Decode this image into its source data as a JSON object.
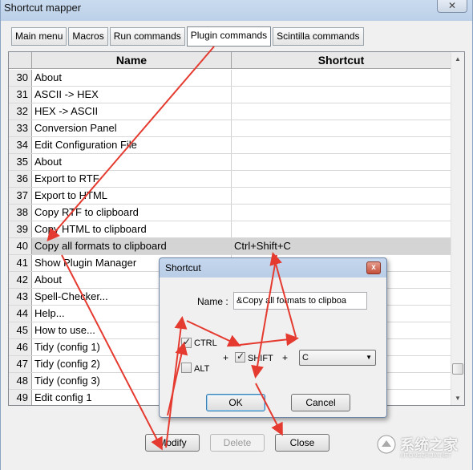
{
  "window": {
    "title": "Shortcut mapper",
    "close_glyph": "✕"
  },
  "tabs": [
    {
      "label": "Main menu",
      "active": false
    },
    {
      "label": "Macros",
      "active": false
    },
    {
      "label": "Run commands",
      "active": false
    },
    {
      "label": "Plugin commands",
      "active": true
    },
    {
      "label": "Scintilla commands",
      "active": false
    }
  ],
  "grid": {
    "headers": {
      "name": "Name",
      "shortcut": "Shortcut"
    },
    "rows": [
      {
        "num": "30",
        "name": "About",
        "shortcut": ""
      },
      {
        "num": "31",
        "name": "ASCII -> HEX",
        "shortcut": ""
      },
      {
        "num": "32",
        "name": "HEX -> ASCII",
        "shortcut": ""
      },
      {
        "num": "33",
        "name": "Conversion Panel",
        "shortcut": ""
      },
      {
        "num": "34",
        "name": "Edit Configuration File",
        "shortcut": ""
      },
      {
        "num": "35",
        "name": "About",
        "shortcut": ""
      },
      {
        "num": "36",
        "name": "Export to RTF",
        "shortcut": ""
      },
      {
        "num": "37",
        "name": "Export to HTML",
        "shortcut": ""
      },
      {
        "num": "38",
        "name": "Copy RTF to clipboard",
        "shortcut": ""
      },
      {
        "num": "39",
        "name": "Copy HTML to clipboard",
        "shortcut": ""
      },
      {
        "num": "40",
        "name": "Copy all formats to clipboard",
        "shortcut": "Ctrl+Shift+C",
        "selected": true
      },
      {
        "num": "41",
        "name": "Show Plugin Manager",
        "shortcut": ""
      },
      {
        "num": "42",
        "name": "About",
        "shortcut": ""
      },
      {
        "num": "43",
        "name": "Spell-Checker...",
        "shortcut": ""
      },
      {
        "num": "44",
        "name": "Help...",
        "shortcut": ""
      },
      {
        "num": "45",
        "name": "How to use...",
        "shortcut": ""
      },
      {
        "num": "46",
        "name": "Tidy (config 1)",
        "shortcut": ""
      },
      {
        "num": "47",
        "name": "Tidy (config 2)",
        "shortcut": ""
      },
      {
        "num": "48",
        "name": "Tidy (config 3)",
        "shortcut": ""
      },
      {
        "num": "49",
        "name": "Edit config 1",
        "shortcut": ""
      }
    ]
  },
  "buttons": {
    "modify": "Modify",
    "delete": "Delete",
    "close": "Close"
  },
  "dialog": {
    "title": "Shortcut",
    "close_glyph": "x",
    "name_label": "Name :",
    "name_value": "&Copy all formats to clipboa",
    "ctrl_label": "CTRL",
    "ctrl_checked": true,
    "alt_label": "ALT",
    "alt_checked": false,
    "shift_label": "SHIFT",
    "shift_checked": true,
    "plus": "+",
    "key_value": "C",
    "ok_label": "OK",
    "cancel_label": "Cancel"
  },
  "watermark": {
    "text": "系统之家",
    "sub": "XITONGZHIJIA.NET"
  },
  "colors": {
    "annotation_arrow": "#e53a2f",
    "selected_row": "#d4d4d4"
  }
}
